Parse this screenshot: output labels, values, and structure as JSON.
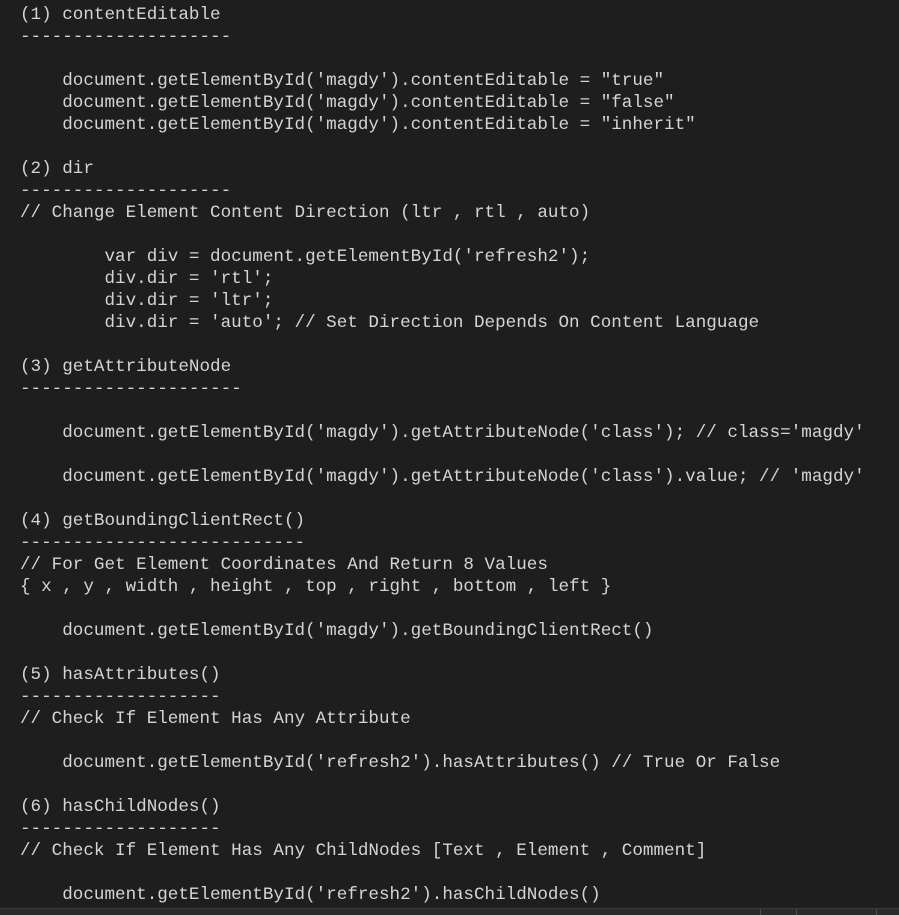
{
  "editor": {
    "lines": [
      "(1) contentEditable",
      "--------------------",
      "",
      "    document.getElementById('magdy').contentEditable = \"true\"",
      "    document.getElementById('magdy').contentEditable = \"false\"",
      "    document.getElementById('magdy').contentEditable = \"inherit\"",
      "",
      "(2) dir",
      "--------------------",
      "// Change Element Content Direction (ltr , rtl , auto)",
      "",
      "        var div = document.getElementById('refresh2');",
      "        div.dir = 'rtl';",
      "        div.dir = 'ltr';",
      "        div.dir = 'auto'; // Set Direction Depends On Content Language",
      "",
      "(3) getAttributeNode",
      "---------------------",
      "",
      "    document.getElementById('magdy').getAttributeNode('class'); // class='magdy'",
      "",
      "    document.getElementById('magdy').getAttributeNode('class').value; // 'magdy'",
      "",
      "(4) getBoundingClientRect()",
      "---------------------------",
      "// For Get Element Coordinates And Return 8 Values",
      "{ x , y , width , height , top , right , bottom , left }",
      "",
      "    document.getElementById('magdy').getBoundingClientRect()",
      "",
      "(5) hasAttributes()",
      "-------------------",
      "// Check If Element Has Any Attribute",
      "",
      "    document.getElementById('refresh2').hasAttributes() // True Or False",
      "",
      "(6) hasChildNodes()",
      "-------------------",
      "// Check If Element Has Any ChildNodes [Text , Element , Comment]",
      "",
      "    document.getElementById('refresh2').hasChildNodes()"
    ]
  },
  "colors": {
    "background": "#1e1e1e",
    "text": "#d4d4d4",
    "statusbar": "#2b2b2b"
  }
}
